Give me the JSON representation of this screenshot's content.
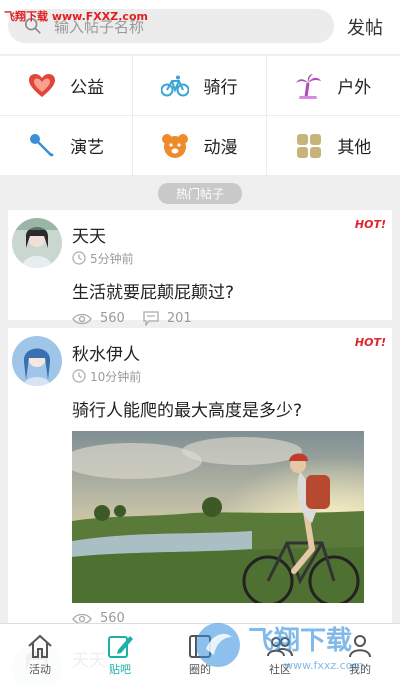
{
  "watermark_top": "飞翔下载 www.FXXZ.com",
  "header": {
    "search_placeholder": "输入帖子名称",
    "post_button": "发帖"
  },
  "categories": [
    {
      "label": "公益",
      "icon": "heart-icon",
      "color": "#e2453a"
    },
    {
      "label": "骑行",
      "icon": "bicycle-icon",
      "color": "#3aa6d6"
    },
    {
      "label": "户外",
      "icon": "palm-tree-icon",
      "color": "#b04ab8"
    },
    {
      "label": "演艺",
      "icon": "microphone-icon",
      "color": "#3a8fd6"
    },
    {
      "label": "动漫",
      "icon": "bear-icon",
      "color": "#f08b2c"
    },
    {
      "label": "其他",
      "icon": "grid-icon",
      "color": "#c8b478"
    }
  ],
  "section_title": "热门帖子",
  "posts": [
    {
      "user": "天天",
      "time": "5分钟前",
      "title": "生活就要屁颠屁颠过?",
      "views": "560",
      "comments": "201",
      "badge": "HOT!"
    },
    {
      "user": "秋水伊人",
      "time": "10分钟前",
      "title": "骑行人能爬的最大高度是多少?",
      "views": "560",
      "badge": "HOT!"
    },
    {
      "user": "天天"
    }
  ],
  "tabs": [
    {
      "label": "活动",
      "icon": "home-icon"
    },
    {
      "label": "贴吧",
      "icon": "edit-icon"
    },
    {
      "label": "圈的",
      "icon": "book-icon"
    },
    {
      "label": "社区",
      "icon": "people-icon"
    },
    {
      "label": "我的",
      "icon": "user-icon"
    }
  ],
  "watermark_bottom": {
    "text": "飞翔下载",
    "url": "www.fxxz.com"
  },
  "colors": {
    "accent": "#1cb0a8",
    "hot": "#e0222a"
  }
}
